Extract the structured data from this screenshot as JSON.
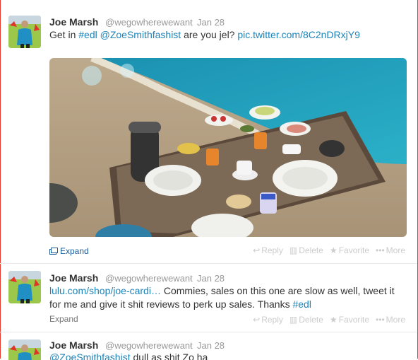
{
  "tweets": [
    {
      "name": "Joe Marsh",
      "handle": "@wegowherewewant",
      "dot": "·",
      "date": "Jan 28",
      "text": {
        "t1": "Get in ",
        "t2": "#edl",
        "t3": " ",
        "t4": "@ZoeSmithfashist",
        "t5": " are you jel? ",
        "t6": "pic.twitter.com/8C2nDRxjY9"
      },
      "expand": "Expand",
      "actions": {
        "reply": "Reply",
        "delete": "Delete",
        "favorite": "Favorite",
        "more": "More"
      }
    },
    {
      "name": "Joe Marsh",
      "handle": "@wegowherewewant",
      "dot": "·",
      "date": "Jan 28",
      "text": {
        "t1": "lulu.com/shop/joe-cardi…",
        "t2": " Commies, sales on this one are slow as well, tweet it for me and give it shit reviews to perk up sales. Thanks ",
        "t3": "#edl"
      },
      "expand": "Expand",
      "actions": {
        "reply": "Reply",
        "delete": "Delete",
        "favorite": "Favorite",
        "more": "More"
      }
    },
    {
      "name": "Joe Marsh",
      "handle": "@wegowherewewant",
      "dot": "·",
      "date": "Jan 28",
      "text": {
        "t1": "@ZoeSmithfashist",
        "t2": " dull as shit Zo ha"
      }
    }
  ],
  "icons": {
    "expand": "expand-icon",
    "reply": "reply-icon",
    "delete": "delete-icon",
    "favorite": "star-icon",
    "more": "more-icon"
  },
  "colors": {
    "link": "#1d83b8",
    "border": "#e23b2d",
    "muted": "#999999"
  }
}
